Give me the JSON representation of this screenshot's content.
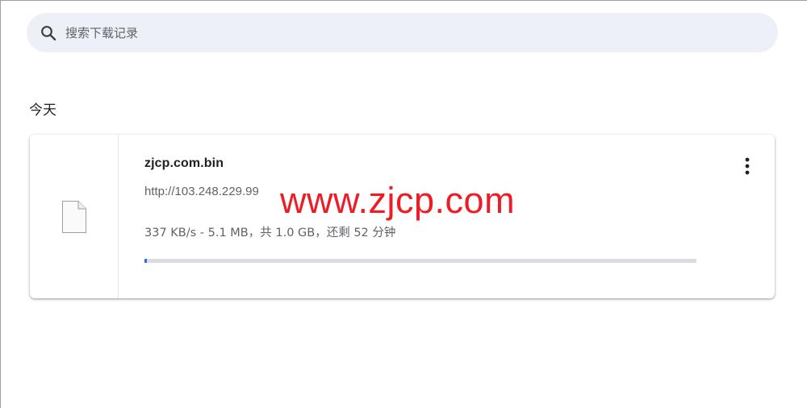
{
  "search": {
    "placeholder": "搜索下载记录",
    "icon": "search-icon"
  },
  "section": {
    "heading": "今天"
  },
  "download": {
    "file_icon": "file-icon",
    "file_name": "zjcp.com.bin",
    "url": "http://103.248.229.99",
    "status": "337 KB/s - 5.1 MB，共 1.0 GB，还剩 52 分钟",
    "progress": 0.005,
    "more_icon": "more-vert-icon"
  },
  "watermark": {
    "text": "www.zjcp.com",
    "color": "#ee1c25"
  },
  "colors": {
    "search_bg": "#eef0f7",
    "progress_track": "#dadce0",
    "progress_fill": "#1a73e8",
    "text_primary": "#202124",
    "text_secondary": "#5f6368"
  }
}
